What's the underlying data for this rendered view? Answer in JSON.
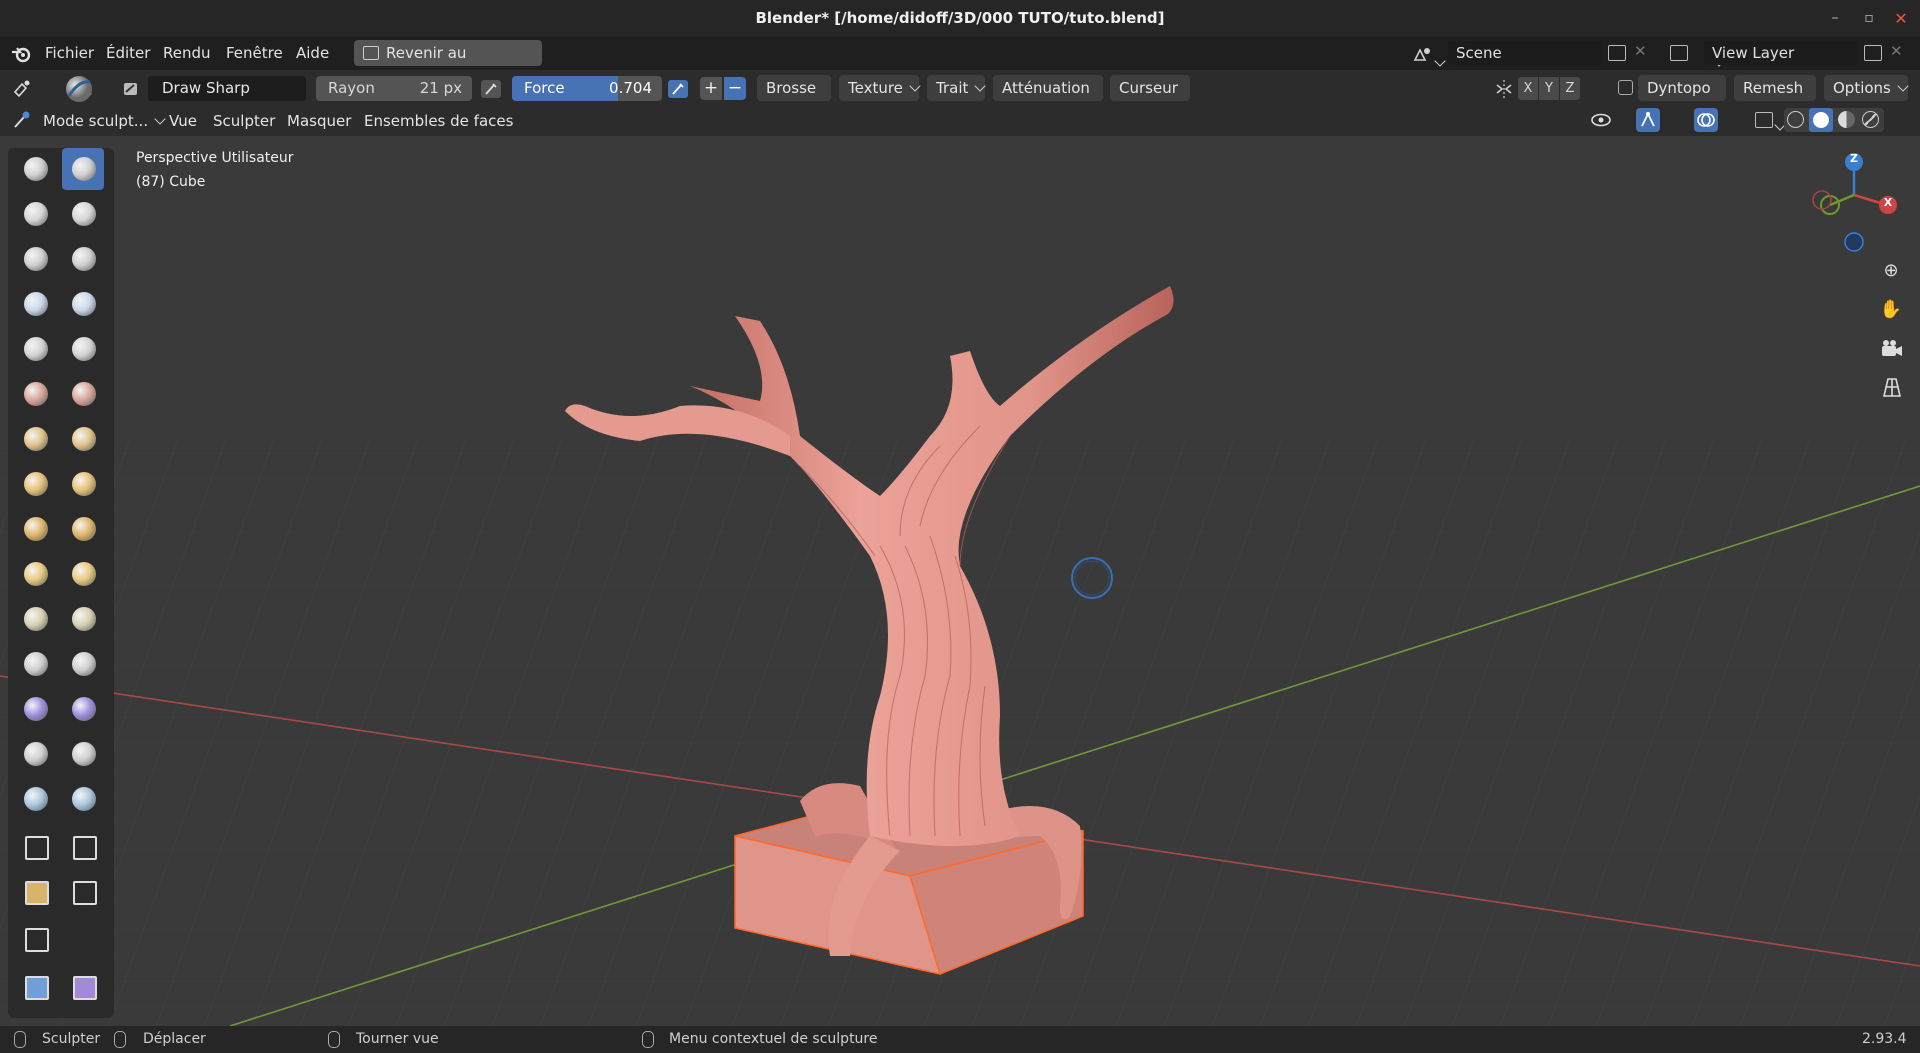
{
  "window": {
    "title": "Blender* [/home/didoff/3D/000 TUTO/tuto.blend]",
    "minimize": "–",
    "restore": "▫",
    "close": "✕"
  },
  "menubar": {
    "items": [
      "Fichier",
      "Éditer",
      "Rendu",
      "Fenêtre",
      "Aide"
    ],
    "revert_label": "Revenir au précédent",
    "scene_label": "Scene",
    "view_layer_label": "View Layer"
  },
  "tool_header": {
    "brush_name": "Draw Sharp",
    "radius_label": "Rayon",
    "radius_value": "21 px",
    "force_label": "Force",
    "force_value": "0.704",
    "force_fraction": 0.704,
    "plus": "+",
    "minus": "−",
    "dropdowns": [
      "Brosse",
      "Texture",
      "Trait",
      "Atténuation",
      "Curseur"
    ],
    "axes": [
      "X",
      "Y",
      "Z"
    ],
    "dyntopo_label": "Dyntopo",
    "remesh_label": "Remesh",
    "options_label": "Options"
  },
  "mode_header": {
    "mode_label": "Mode sculpt...",
    "menus": [
      "Vue",
      "Sculpter",
      "Masquer",
      "Ensembles de faces"
    ]
  },
  "viewport": {
    "perspective_label": "Perspective Utilisateur",
    "object_label": "(87) Cube",
    "gizmo": {
      "z": "Z",
      "x": "X"
    }
  },
  "statusbar": {
    "sculpt_label": "Sculpter",
    "move_label": "Déplacer",
    "rotate_label": "Tourner vue",
    "context_label": "Menu contextuel de sculpture",
    "version": "2.93.4"
  },
  "colors": {
    "accent": "#4772b3",
    "mesh": "#e8988d",
    "selection_outline": "#ff6a2c",
    "x_axis": "#a84a44",
    "y_axis": "#6f9a3a"
  }
}
